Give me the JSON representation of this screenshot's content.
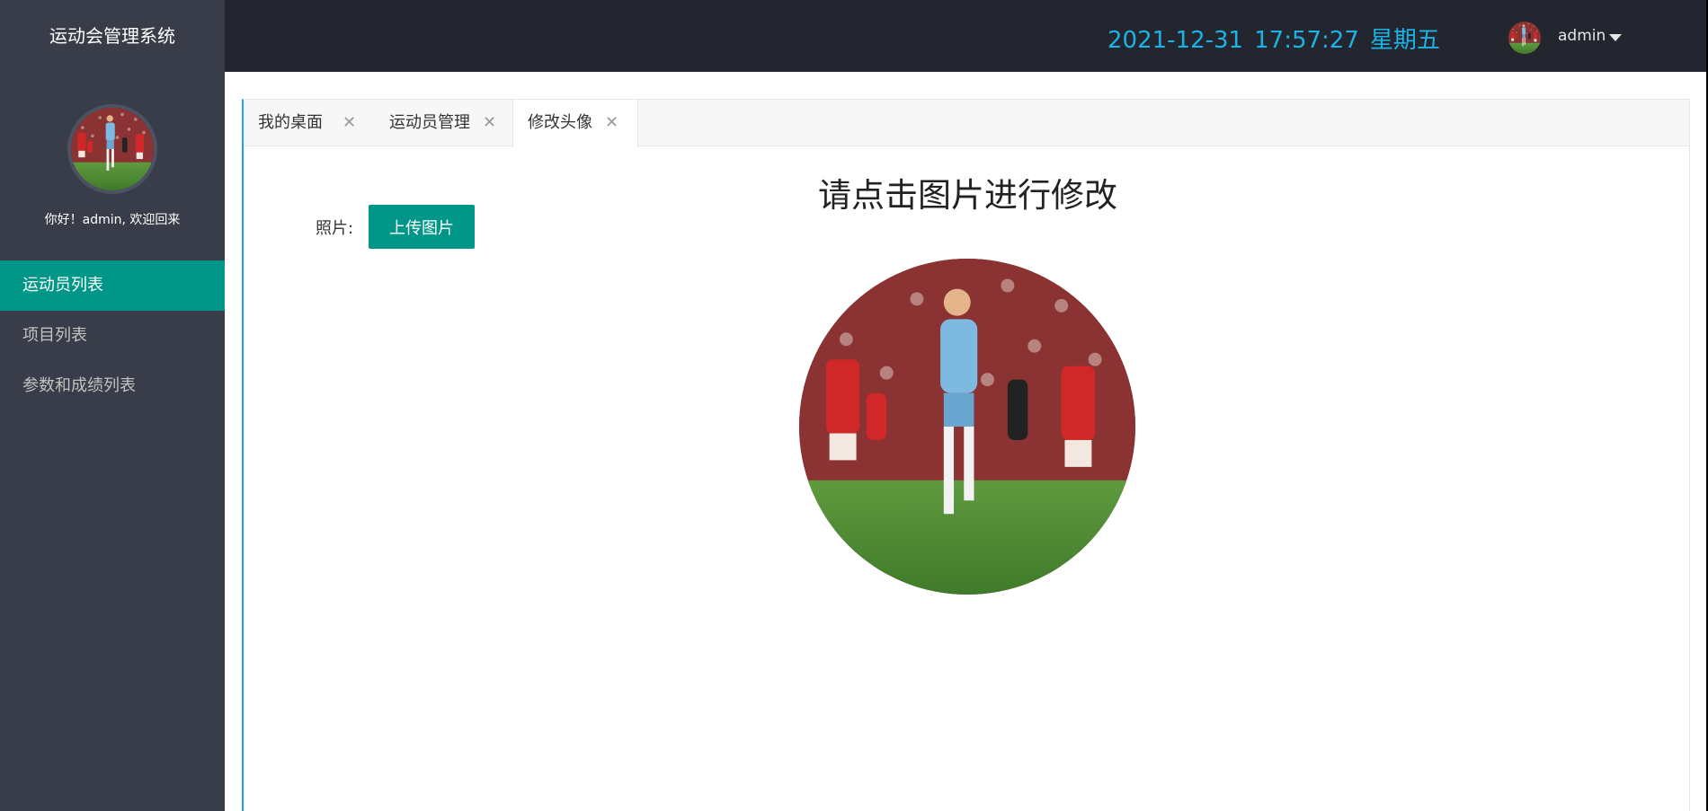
{
  "app": {
    "title": "运动会管理系统"
  },
  "sidebar": {
    "welcome": "你好！admin, 欢迎回来",
    "items": [
      {
        "label": "运动员列表",
        "active": true
      },
      {
        "label": "项目列表",
        "active": false
      },
      {
        "label": "参数和成绩列表",
        "active": false
      }
    ]
  },
  "header": {
    "date": "2021-12-31",
    "time": "17:57:27",
    "weekday": "星期五",
    "username": "admin",
    "clock_color": "#1ab3e6"
  },
  "tabs": [
    {
      "label": "我的桌面",
      "active": false
    },
    {
      "label": "运动员管理",
      "active": false
    },
    {
      "label": "修改头像",
      "active": true
    }
  ],
  "main": {
    "heading": "请点击图片进行修改",
    "photo_label": "照片:",
    "upload_label": "上传图片"
  },
  "colors": {
    "accent": "#009688",
    "sidebar_bg": "#393d49",
    "header_bg": "#23262e",
    "tab_highlight": "#1e9fff"
  }
}
